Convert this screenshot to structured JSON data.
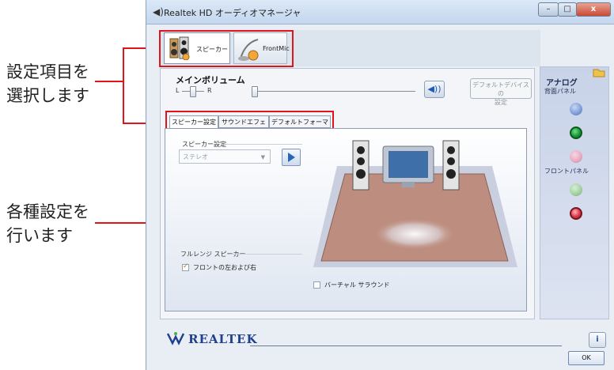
{
  "annotations": {
    "select_items": [
      "設定項目を",
      "選択します"
    ],
    "settings": [
      "各種設定を",
      "行います"
    ]
  },
  "window": {
    "title": "Realtek HD オーディオマネージャ",
    "buttons": {
      "minimize": "–",
      "maximize": "□",
      "close": "x"
    }
  },
  "devices": [
    {
      "label": "スピーカー",
      "selected": true
    },
    {
      "label": "FrontMic",
      "selected": false
    }
  ],
  "volume": {
    "title": "メインボリューム",
    "left_label": "L",
    "right_label": "R",
    "default_device_button": [
      "デフォルトデバイスの",
      "設定"
    ]
  },
  "tabs": [
    {
      "label": "スピーカー設定",
      "selected": true
    },
    {
      "label": "サウンドエフェクト",
      "selected": false
    },
    {
      "label": "デフォルトフォーマット",
      "selected": false
    }
  ],
  "speaker_settings": {
    "group_label": "スピーカー設定",
    "select_value": "ステレオ",
    "fullrange_group_label": "フルレンジ スピーカー",
    "front_lr_label": "フロントの左および右",
    "front_lr_checked": true,
    "virtual_surround_label": "バーチャル サラウンド",
    "virtual_surround_checked": false
  },
  "jack_panel": {
    "title": "アナログ",
    "rear_label": "背面パネル",
    "front_label": "フロントパネル",
    "colors": {
      "blue": "#7d9bd6",
      "green": "#1c9a3a",
      "pink": "#e6a9bf",
      "light_green": "#9fcf9f",
      "red": "#d83a4a"
    }
  },
  "footer": {
    "brand": "REALTEK",
    "info_button": "i",
    "ok_button": "OK"
  },
  "colors": {
    "annotation_red": "#e1141c"
  }
}
